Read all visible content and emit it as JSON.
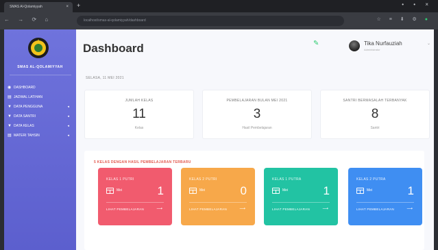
{
  "browser": {
    "tab_title": "SMAS Al-Qolamiyyah",
    "tab_close": "×",
    "new_tab": "+",
    "window_controls": "• • ×",
    "nav_buttons": "← → ⟳ ⌂",
    "url": "localhost/smas-al-qolamiyyah/dashboard",
    "toolbar_icons": "☆ ≡ ⬇ ⚙",
    "toolbar_status": "●"
  },
  "sidebar": {
    "brand": "SMAS AL-QOLAMIYYAH",
    "items": [
      {
        "icon": "◉",
        "label": "DASHBOARD",
        "caret": ""
      },
      {
        "icon": "▤",
        "label": "JADWAL LATIHAN",
        "caret": ""
      },
      {
        "icon": "▼",
        "label": "DATA PENGGUNA",
        "caret": "◂"
      },
      {
        "icon": "▼",
        "label": "DATA SANTRI",
        "caret": "◂"
      },
      {
        "icon": "▼",
        "label": "DATA KELAS",
        "caret": "◂"
      },
      {
        "icon": "▤",
        "label": "MATERI TAHSIN",
        "caret": "◂"
      }
    ]
  },
  "header": {
    "title": "Dashboard",
    "bell": "✎",
    "user_name": "Tika Nurfauziah",
    "user_role": "Administrator",
    "caret": "⌄"
  },
  "date": "SELASA, 11 MEI 2021",
  "stats": [
    {
      "label": "JUMLAH KELAS",
      "value": "11",
      "unit": "Kelas"
    },
    {
      "label": "PEMBELAJARAN BULAN MEI 2021",
      "value": "3",
      "unit": "Hasil Pembelajaran"
    },
    {
      "label": "SANTRI BERMASALAH TERBANYAK",
      "value": "8",
      "unit": "Santri"
    }
  ],
  "panel_title": "5 KELAS DENGAN HASIL PEMBELAJARAN TERBARU",
  "cards": [
    {
      "label": "KELAS 1 PUTRI",
      "sub": "Mei",
      "value": "1",
      "link": "LIHAT PEMBELAJARAN",
      "arrow": "⟶",
      "color": "#f15b6e"
    },
    {
      "label": "KELAS 2 PUTRI",
      "sub": "Mei",
      "value": "0",
      "link": "LIHAT PEMBELAJARAN",
      "arrow": "⟶",
      "color": "#f7a84a"
    },
    {
      "label": "KELAS 1 PUTRA",
      "sub": "Mei",
      "value": "1",
      "link": "LIHAT PEMBELAJARAN",
      "arrow": "⟶",
      "color": "#22c3a3"
    },
    {
      "label": "KELAS 2 PUTRA",
      "sub": "Mei",
      "value": "1",
      "link": "LIHAT PEMBELAJARAN",
      "arrow": "⟶",
      "color": "#3f8ef2"
    }
  ]
}
